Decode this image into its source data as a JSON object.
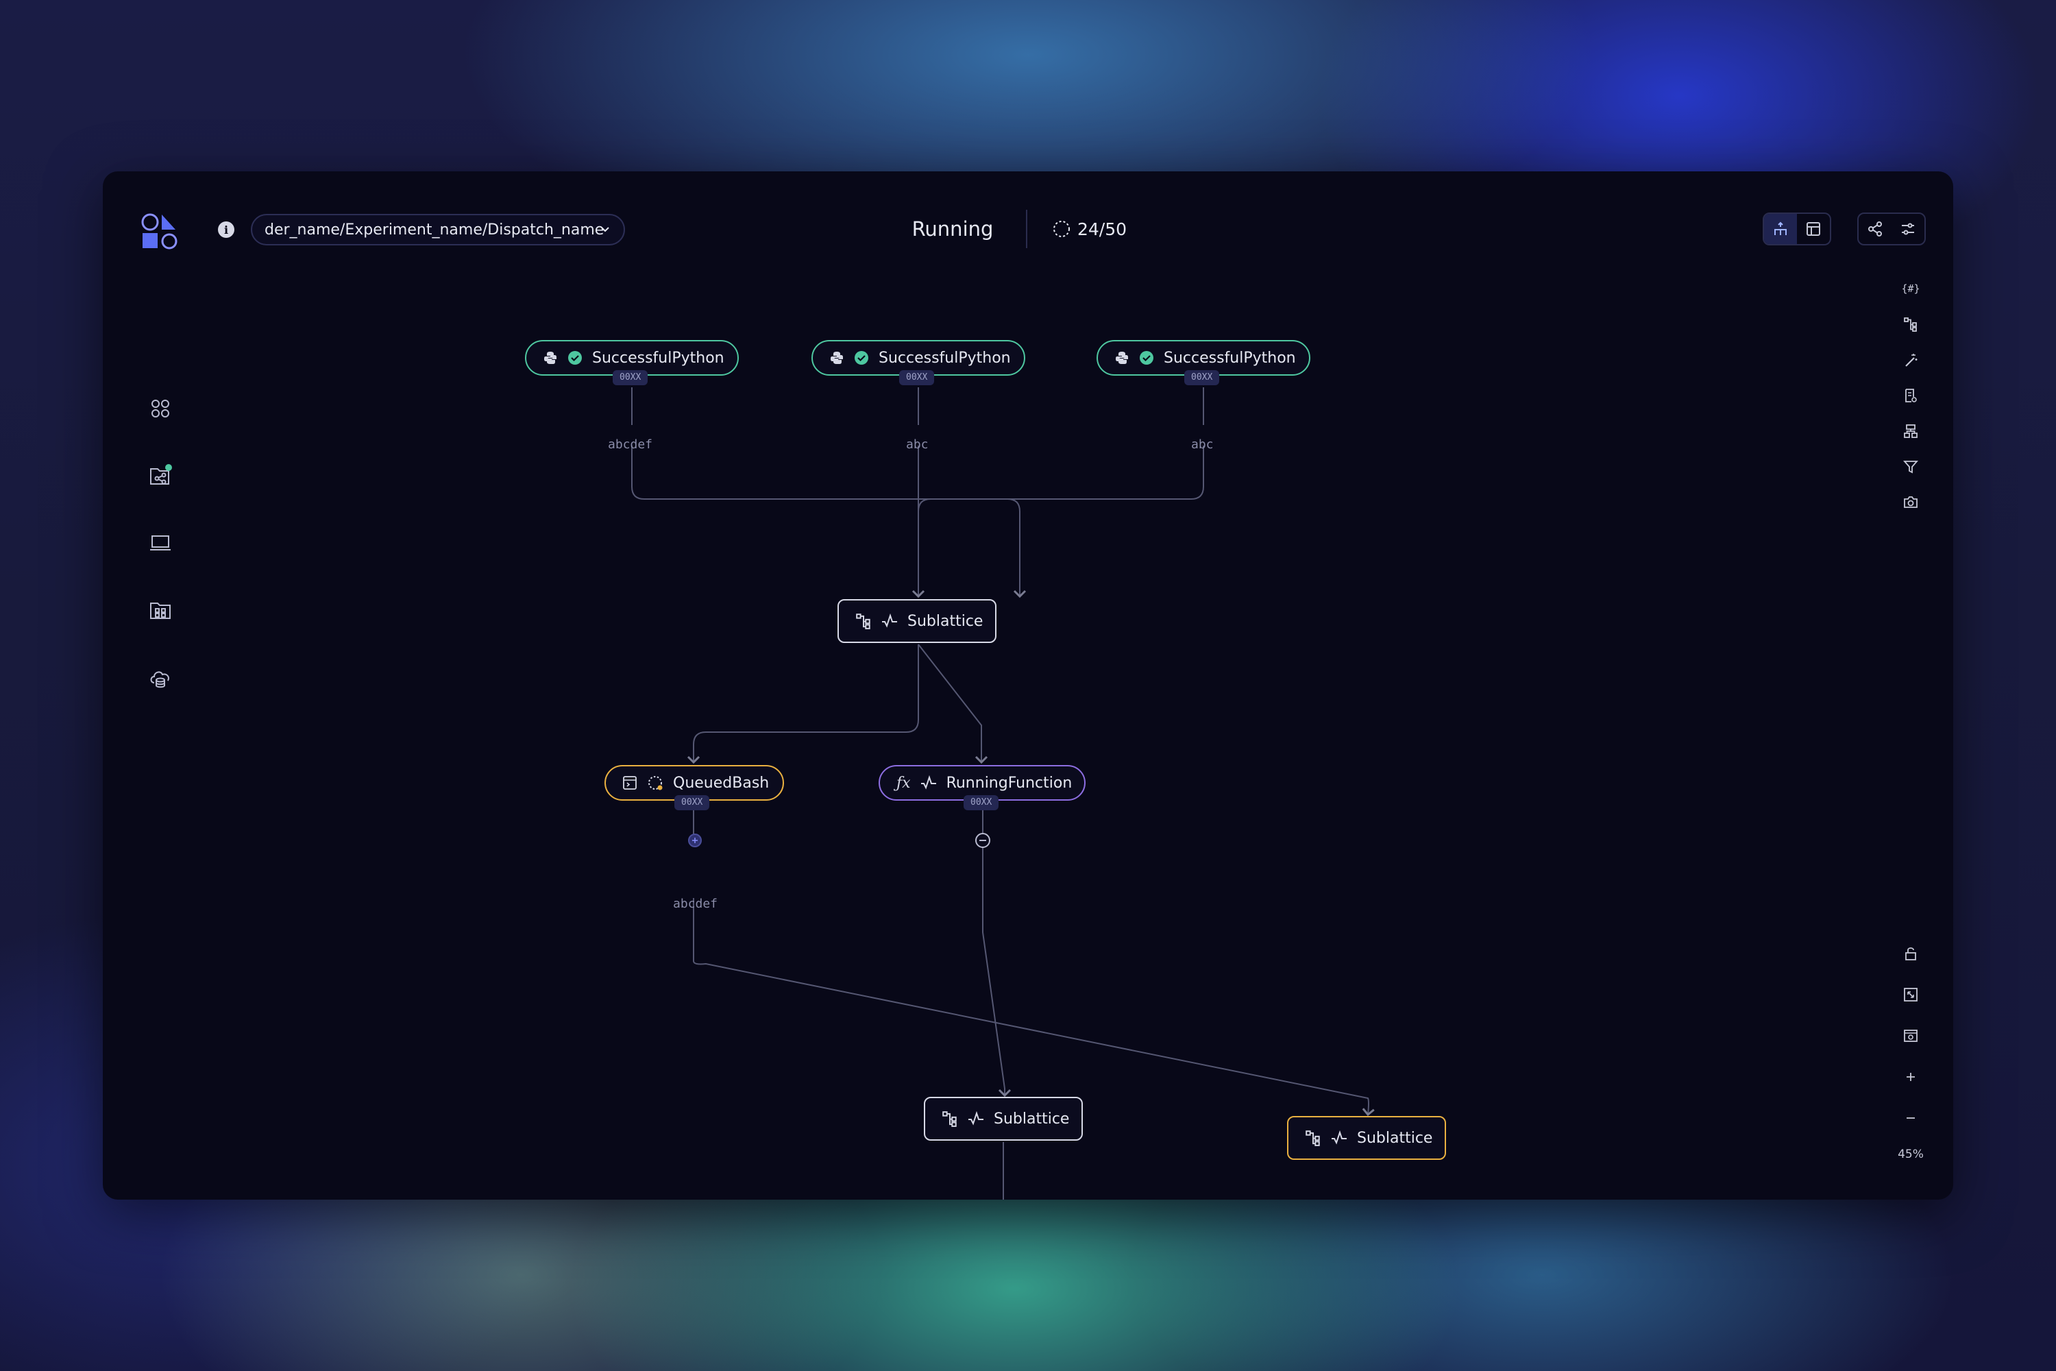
{
  "header": {
    "breadcrumb": "der_name/Experiment_name/Dispatch_name",
    "status": "Running",
    "progress": "24/50"
  },
  "icons": {
    "logo": "covalent-logo",
    "info": "info-icon",
    "left_nav": [
      "dashboard-icon",
      "lattices-icon",
      "terminal-icon",
      "library-icon",
      "cloud-icon"
    ],
    "right_toolbar": [
      "code-icon",
      "tree-icon",
      "wand-icon",
      "file-icon",
      "layout-icon",
      "filter-icon",
      "camera-icon"
    ],
    "zoom_toolbar": [
      "lock-icon",
      "fit-view-icon",
      "screenshot-icon",
      "zoom-in-icon",
      "zoom-out-icon"
    ]
  },
  "colors": {
    "success": "#4ec7a0",
    "queued": "#e9b040",
    "running": "#8c6de0",
    "accent": "#5b6ef5",
    "notification": "#4ec7a0"
  },
  "graph": {
    "nodes": [
      {
        "label": "SuccessfulPython",
        "status": "success",
        "type": "python",
        "id": "00XX"
      },
      {
        "label": "SuccessfulPython",
        "status": "success",
        "type": "python",
        "id": "00XX"
      },
      {
        "label": "SuccessfulPython",
        "status": "success",
        "type": "python",
        "id": "00XX"
      },
      {
        "label": "Sublattice",
        "status": "running",
        "type": "sublattice"
      },
      {
        "label": "QueuedBash",
        "status": "queued",
        "type": "bash",
        "id": "00XX"
      },
      {
        "label": "RunningFunction",
        "status": "running",
        "type": "function",
        "id": "00XX"
      },
      {
        "label": "Sublattice",
        "status": "running",
        "type": "sublattice"
      },
      {
        "label": "Sublattice",
        "status": "queued",
        "type": "sublattice"
      }
    ],
    "edge_labels": [
      "abcdef",
      "abc",
      "abc",
      "abcdef"
    ]
  },
  "zoom": "45%"
}
